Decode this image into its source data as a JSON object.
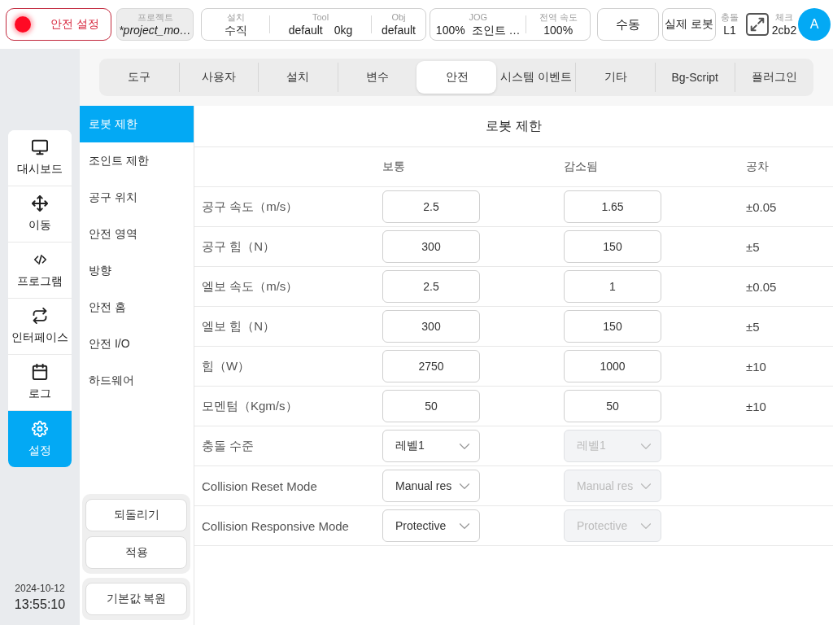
{
  "top_bar": {
    "safety_button": {
      "label": "안전 설정"
    },
    "project": {
      "label": "프로젝트",
      "value": "*project_mo…"
    },
    "installation": [
      {
        "label": "설치",
        "values": [
          "수직"
        ]
      },
      {
        "label": "Tool",
        "values": [
          "default",
          "0kg"
        ]
      },
      {
        "label": "Obj",
        "values": [
          "default"
        ]
      }
    ],
    "jog": [
      {
        "label": "JOG",
        "values": [
          "100%",
          "조인트 …"
        ]
      },
      {
        "label": "전역 속도",
        "values": [
          "100%"
        ]
      }
    ],
    "mode_button": "수동",
    "robot_button": "실제 로봇",
    "collision": {
      "label": "충돌",
      "value": "L1"
    },
    "check": {
      "label": "체크",
      "value": "2cb2"
    },
    "avatar": "A"
  },
  "nav": [
    {
      "label": "대시보드",
      "selected": false
    },
    {
      "label": "이동",
      "selected": false
    },
    {
      "label": "프로그램",
      "selected": false
    },
    {
      "label": "인터페이스",
      "selected": false
    },
    {
      "label": "로그",
      "selected": false
    },
    {
      "label": "설정",
      "selected": true
    }
  ],
  "clock": {
    "date": "2024-10-12",
    "time": "13:55:10"
  },
  "tabs": [
    {
      "label": "도구",
      "selected": false
    },
    {
      "label": "사용자",
      "selected": false
    },
    {
      "label": "설치",
      "selected": false
    },
    {
      "label": "변수",
      "selected": false
    },
    {
      "label": "안전",
      "selected": true
    },
    {
      "label": "시스템 이벤트",
      "selected": false
    },
    {
      "label": "기타",
      "selected": false
    },
    {
      "label": "Bg-Script",
      "selected": false
    },
    {
      "label": "플러그인",
      "selected": false
    }
  ],
  "side_menu": [
    {
      "label": "로봇 제한",
      "selected": true
    },
    {
      "label": "조인트 제한",
      "selected": false
    },
    {
      "label": "공구 위치",
      "selected": false
    },
    {
      "label": "안전 영역",
      "selected": false
    },
    {
      "label": "방향",
      "selected": false
    },
    {
      "label": "안전 홈",
      "selected": false
    },
    {
      "label": "안전 I/O",
      "selected": false
    },
    {
      "label": "하드웨어",
      "selected": false
    }
  ],
  "action_groups": [
    {
      "buttons": [
        "되돌리기",
        "적용"
      ]
    },
    {
      "buttons": [
        "기본값 복원"
      ]
    }
  ],
  "panel": {
    "title": "로봇 제한",
    "columns": [
      "보통",
      "감소됨",
      "공차"
    ],
    "rows": [
      {
        "label": "공구 속도（m/s）",
        "kind": "number",
        "normal": {
          "value": "2.5",
          "disabled": false
        },
        "reduced": {
          "value": "1.65",
          "disabled": false
        },
        "tolerance": "±0.05"
      },
      {
        "label": "공구 힘（N）",
        "kind": "number",
        "normal": {
          "value": "300",
          "disabled": false
        },
        "reduced": {
          "value": "150",
          "disabled": false
        },
        "tolerance": "±5"
      },
      {
        "label": "엘보 속도（m/s）",
        "kind": "number",
        "normal": {
          "value": "2.5",
          "disabled": false
        },
        "reduced": {
          "value": "1",
          "disabled": false
        },
        "tolerance": "±0.05"
      },
      {
        "label": "엘보 힘（N）",
        "kind": "number",
        "normal": {
          "value": "300",
          "disabled": false
        },
        "reduced": {
          "value": "150",
          "disabled": false
        },
        "tolerance": "±5"
      },
      {
        "label": "힘（W）",
        "kind": "number",
        "normal": {
          "value": "2750",
          "disabled": false
        },
        "reduced": {
          "value": "1000",
          "disabled": false
        },
        "tolerance": "±10"
      },
      {
        "label": "모멘텀（Kgm/s）",
        "kind": "number",
        "normal": {
          "value": "50",
          "disabled": false
        },
        "reduced": {
          "value": "50",
          "disabled": false
        },
        "tolerance": "±10"
      },
      {
        "label": "충돌 수준",
        "kind": "select",
        "normal": {
          "value": "레벨1",
          "disabled": false
        },
        "reduced": {
          "value": "레벨1",
          "disabled": true
        }
      },
      {
        "label": "Collision Reset Mode",
        "kind": "select",
        "normal": {
          "value": "Manual res",
          "disabled": false
        },
        "reduced": {
          "value": "Manual res",
          "disabled": true
        }
      },
      {
        "label": "Collision Responsive Mode",
        "kind": "select",
        "normal": {
          "value": "Protective",
          "disabled": false
        },
        "reduced": {
          "value": "Protective",
          "disabled": true
        }
      }
    ]
  }
}
